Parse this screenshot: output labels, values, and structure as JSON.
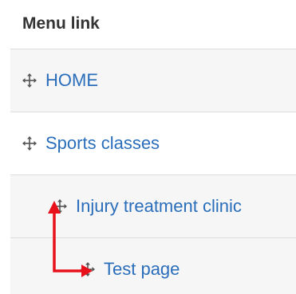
{
  "section": {
    "title": "Menu link"
  },
  "menu_items": [
    {
      "label": "HOME",
      "depth": 0,
      "icon": "drag-handle-icon"
    },
    {
      "label": "Sports classes",
      "depth": 0,
      "icon": "drag-handle-icon"
    },
    {
      "label": "Injury treatment clinic",
      "depth": 1,
      "icon": "drag-handle-icon"
    },
    {
      "label": "Test page",
      "depth": 2,
      "icon": "drag-handle-icon"
    }
  ],
  "colors": {
    "link": "#2a6ebb",
    "heading": "#333333",
    "row_alt": "#f6f6f6",
    "border": "#dcdcdc",
    "annotation_arrow": "#e8101a"
  }
}
